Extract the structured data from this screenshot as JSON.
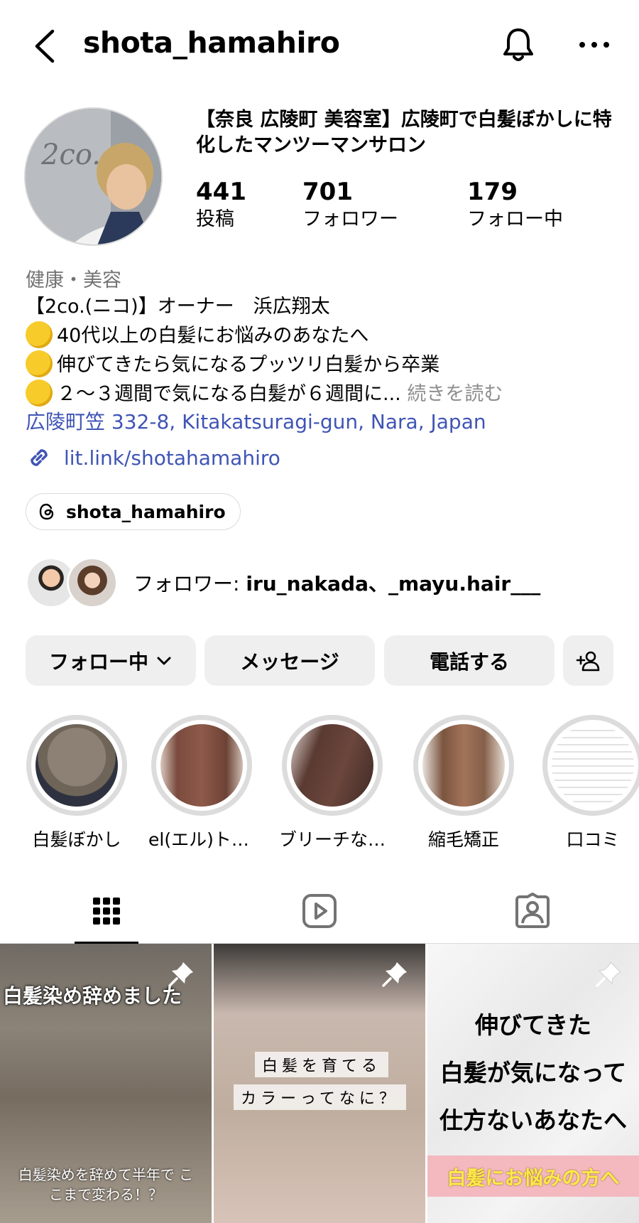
{
  "header": {
    "username": "shota_hamahiro"
  },
  "profile": {
    "bio_title": "【奈良 広陵町 美容室】広陵町で白髪ぼかしに特化したマンツーマンサロン",
    "stats": [
      {
        "value": "441",
        "label": "投稿"
      },
      {
        "value": "701",
        "label": "フォロワー"
      },
      {
        "value": "179",
        "label": "フォロー中"
      }
    ],
    "category": "健康・美容",
    "bio_lines": [
      "【2co.(ニコ)】オーナー　浜広翔太",
      "40代以上の白髪にお悩みのあなたへ",
      "伸びてきたら気になるプッツリ白髪から卒業",
      "２〜３週間で気になる白髪が６週間に..."
    ],
    "more_label": "続きを読む",
    "address": "広陵町笠 332-8, Kitakatsuragi-gun, Nara, Japan",
    "link": "lit.link/shotahamahiro",
    "threads_handle": "shota_hamahiro",
    "followed_by_prefix": "フォロワー: ",
    "followed_by_names": "iru_nakada、_mayu.hair___"
  },
  "actions": {
    "following": "フォロー中",
    "message": "メッセージ",
    "call": "電話する"
  },
  "highlights": [
    {
      "label": "白髪ぼかし"
    },
    {
      "label": "el(エル)トリ…"
    },
    {
      "label": "ブリーチな…"
    },
    {
      "label": "縮毛矯正"
    },
    {
      "label": "口コミ"
    }
  ],
  "posts": [
    {
      "banner": "白髪染め辞めました",
      "bottom": "白髪染めを辞めて半年で ここまで変わる！？"
    },
    {
      "line1": "白髪を育てる",
      "line2": "カラーってなに？"
    },
    {
      "line1": "伸びてきた",
      "line2": "白髪が気になって",
      "line3": "仕方ないあなたへ",
      "banner": "白髪にお悩みの方へ"
    }
  ],
  "colors": {
    "link": "#3f54b5",
    "button_bg": "#efefef",
    "secondary_text": "#737373"
  }
}
